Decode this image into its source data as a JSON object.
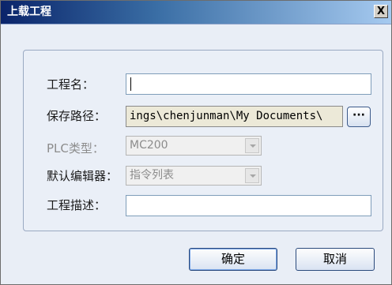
{
  "window": {
    "title": "上载工程",
    "close_glyph": "X"
  },
  "form": {
    "project_name_label": "工程名：",
    "project_name_value": "",
    "save_path_label": "保存路径：",
    "save_path_value": "ings\\chenjunman\\My Documents\\",
    "browse_label": "···",
    "plc_type_label": "PLC类型：",
    "plc_type_value": "MC200",
    "default_editor_label": "默认编辑器：",
    "default_editor_value": "指令列表",
    "description_label": "工程描述：",
    "description_value": ""
  },
  "buttons": {
    "ok": "确定",
    "cancel": "取消"
  }
}
